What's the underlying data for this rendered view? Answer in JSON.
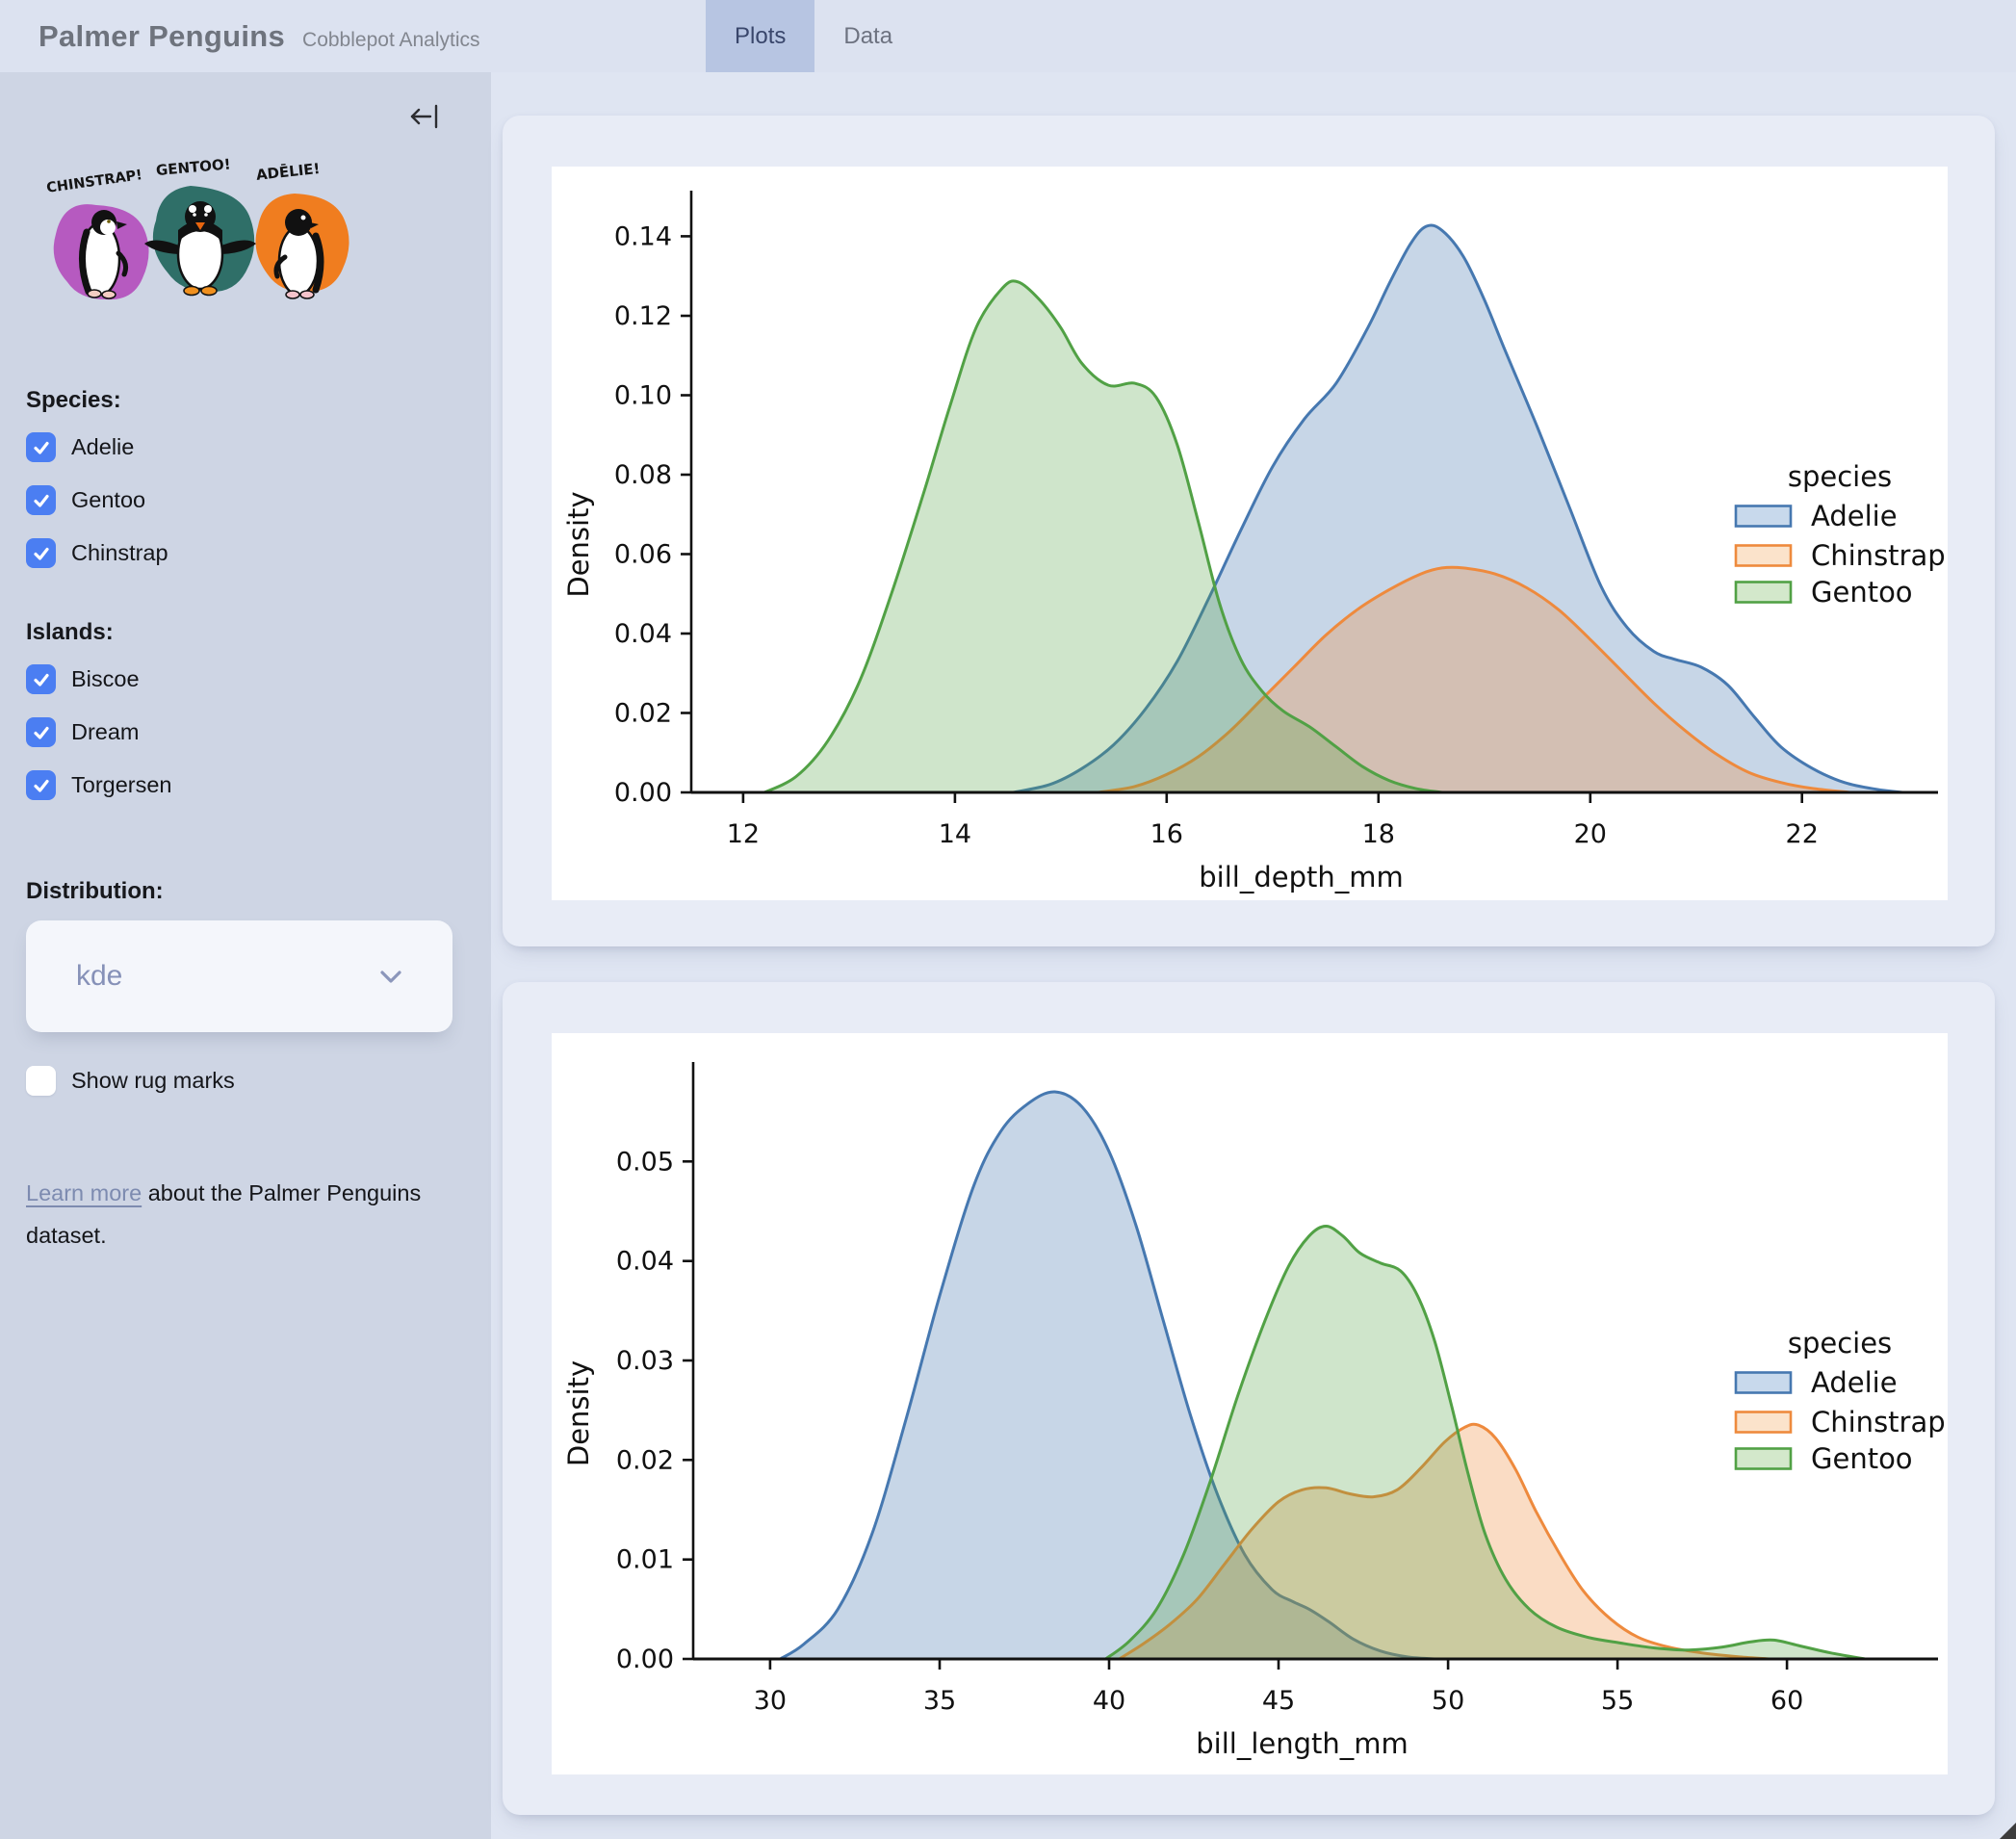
{
  "header": {
    "title": "Palmer Penguins",
    "subtitle": "Cobblepot Analytics",
    "tabs": [
      {
        "label": "Plots",
        "active": true
      },
      {
        "label": "Data",
        "active": false
      }
    ]
  },
  "sidebar": {
    "collapse_icon": "arrow-to-bar-left",
    "penguin_labels": [
      "CHINSTRAP!",
      "GENTOO!",
      "ADĒLIE!"
    ],
    "penguin_splash_colors": [
      "#b65ac0",
      "#2f6f68",
      "#f07d1f"
    ],
    "species_label": "Species:",
    "species": [
      {
        "label": "Adelie",
        "checked": true
      },
      {
        "label": "Gentoo",
        "checked": true
      },
      {
        "label": "Chinstrap",
        "checked": true
      }
    ],
    "islands_label": "Islands:",
    "islands": [
      {
        "label": "Biscoe",
        "checked": true
      },
      {
        "label": "Dream",
        "checked": true
      },
      {
        "label": "Torgersen",
        "checked": true
      }
    ],
    "distribution_label": "Distribution:",
    "distribution_value": "kde",
    "rug_label": "Show rug marks",
    "rug_checked": false,
    "learn_more_link": "Learn more",
    "learn_more_rest": " about the Palmer Penguins dataset.",
    "checkbox_color": "#4b7ef2"
  },
  "chart_data": [
    {
      "type": "area",
      "kind": "kde-density",
      "title": "",
      "xlabel": "bill_depth_mm",
      "ylabel": "Density",
      "xlim": [
        11.51,
        23.03
      ],
      "ylim": [
        0,
        0.1515
      ],
      "grid": false,
      "legend": {
        "title": "species",
        "position": "center right"
      },
      "xticks": {
        "values": [
          12,
          14,
          16,
          18,
          20,
          22
        ],
        "labels": [
          "12",
          "14",
          "16",
          "18",
          "20",
          "22"
        ]
      },
      "yticks": {
        "values": [
          0,
          0.02,
          0.04,
          0.06,
          0.08,
          0.1,
          0.12,
          0.14
        ],
        "labels": [
          "0.00",
          "0.02",
          "0.04",
          "0.06",
          "0.08",
          "0.10",
          "0.12",
          "0.14"
        ]
      },
      "series": [
        {
          "name": "Adelie",
          "line_color": "#4678b0",
          "fill_color": "rgba(70,120,176,0.30)",
          "swatch_fill": "#c8d9ec",
          "points": [
            [
              14.55,
              0
            ],
            [
              14.9,
              0.002
            ],
            [
              15.2,
              0.006
            ],
            [
              15.5,
              0.012
            ],
            [
              15.8,
              0.021
            ],
            [
              16.1,
              0.033
            ],
            [
              16.4,
              0.049
            ],
            [
              16.7,
              0.066
            ],
            [
              17.0,
              0.082
            ],
            [
              17.3,
              0.094
            ],
            [
              17.6,
              0.103
            ],
            [
              17.9,
              0.117
            ],
            [
              18.1,
              0.128
            ],
            [
              18.3,
              0.138
            ],
            [
              18.45,
              0.1425
            ],
            [
              18.6,
              0.1415
            ],
            [
              18.8,
              0.135
            ],
            [
              19.0,
              0.124
            ],
            [
              19.2,
              0.111
            ],
            [
              19.5,
              0.092
            ],
            [
              19.8,
              0.072
            ],
            [
              20.1,
              0.052
            ],
            [
              20.35,
              0.0415
            ],
            [
              20.6,
              0.0355
            ],
            [
              20.8,
              0.0335
            ],
            [
              21.05,
              0.0315
            ],
            [
              21.3,
              0.027
            ],
            [
              21.55,
              0.019
            ],
            [
              21.8,
              0.0115
            ],
            [
              22.1,
              0.006
            ],
            [
              22.4,
              0.0025
            ],
            [
              22.7,
              0.0008
            ],
            [
              22.95,
              0
            ]
          ]
        },
        {
          "name": "Chinstrap",
          "line_color": "#ee8a3d",
          "fill_color": "rgba(238,138,61,0.30)",
          "swatch_fill": "#fbe3cb",
          "points": [
            [
              15.35,
              0
            ],
            [
              15.7,
              0.0015
            ],
            [
              16.0,
              0.0045
            ],
            [
              16.3,
              0.009
            ],
            [
              16.6,
              0.0155
            ],
            [
              16.9,
              0.0235
            ],
            [
              17.2,
              0.0315
            ],
            [
              17.5,
              0.0395
            ],
            [
              17.8,
              0.046
            ],
            [
              18.1,
              0.051
            ],
            [
              18.4,
              0.055
            ],
            [
              18.6,
              0.0565
            ],
            [
              18.8,
              0.0565
            ],
            [
              19.1,
              0.055
            ],
            [
              19.4,
              0.0515
            ],
            [
              19.7,
              0.046
            ],
            [
              20.0,
              0.0385
            ],
            [
              20.3,
              0.0305
            ],
            [
              20.6,
              0.0225
            ],
            [
              20.9,
              0.0155
            ],
            [
              21.2,
              0.0095
            ],
            [
              21.5,
              0.005
            ],
            [
              21.8,
              0.0025
            ],
            [
              22.1,
              0.001
            ],
            [
              22.45,
              0
            ]
          ]
        },
        {
          "name": "Gentoo",
          "line_color": "#51a145",
          "fill_color": "rgba(81,161,69,0.28)",
          "swatch_fill": "#d3e8cb",
          "points": [
            [
              12.2,
              0
            ],
            [
              12.5,
              0.004
            ],
            [
              12.8,
              0.013
            ],
            [
              13.1,
              0.028
            ],
            [
              13.4,
              0.05
            ],
            [
              13.7,
              0.075
            ],
            [
              13.95,
              0.097
            ],
            [
              14.2,
              0.117
            ],
            [
              14.45,
              0.127
            ],
            [
              14.6,
              0.1285
            ],
            [
              14.8,
              0.124
            ],
            [
              15.0,
              0.117
            ],
            [
              15.2,
              0.108
            ],
            [
              15.45,
              0.1025
            ],
            [
              15.7,
              0.103
            ],
            [
              15.9,
              0.0995
            ],
            [
              16.1,
              0.0875
            ],
            [
              16.3,
              0.068
            ],
            [
              16.5,
              0.0475
            ],
            [
              16.7,
              0.0335
            ],
            [
              16.9,
              0.0255
            ],
            [
              17.1,
              0.0205
            ],
            [
              17.35,
              0.0165
            ],
            [
              17.6,
              0.0115
            ],
            [
              17.85,
              0.0065
            ],
            [
              18.1,
              0.003
            ],
            [
              18.35,
              0.001
            ],
            [
              18.6,
              0
            ]
          ]
        }
      ]
    },
    {
      "type": "area",
      "kind": "kde-density",
      "title": "",
      "xlabel": "bill_length_mm",
      "ylabel": "Density",
      "xlim": [
        27.73,
        63.66
      ],
      "ylim": [
        0,
        0.06
      ],
      "grid": false,
      "legend": {
        "title": "species",
        "position": "center right"
      },
      "xticks": {
        "values": [
          30,
          35,
          40,
          45,
          50,
          55,
          60
        ],
        "labels": [
          "30",
          "35",
          "40",
          "45",
          "50",
          "55",
          "60"
        ]
      },
      "yticks": {
        "values": [
          0,
          0.01,
          0.02,
          0.03,
          0.04,
          0.05
        ],
        "labels": [
          "0.00",
          "0.01",
          "0.02",
          "0.03",
          "0.04",
          "0.05"
        ]
      },
      "series": [
        {
          "name": "Adelie",
          "line_color": "#4678b0",
          "fill_color": "rgba(70,120,176,0.30)",
          "swatch_fill": "#c8d9ec",
          "points": [
            [
              30.3,
              0
            ],
            [
              31,
              0.0015
            ],
            [
              32,
              0.005
            ],
            [
              33,
              0.0125
            ],
            [
              34,
              0.024
            ],
            [
              35,
              0.0365
            ],
            [
              36,
              0.0475
            ],
            [
              36.8,
              0.053
            ],
            [
              37.6,
              0.0558
            ],
            [
              38.4,
              0.057
            ],
            [
              39.2,
              0.0555
            ],
            [
              40,
              0.051
            ],
            [
              40.8,
              0.0435
            ],
            [
              41.6,
              0.034
            ],
            [
              42.4,
              0.0245
            ],
            [
              43.2,
              0.0165
            ],
            [
              44,
              0.0105
            ],
            [
              44.8,
              0.007
            ],
            [
              45.4,
              0.0058
            ],
            [
              45.9,
              0.005
            ],
            [
              46.5,
              0.0037
            ],
            [
              47.2,
              0.002
            ],
            [
              48,
              0.0008
            ],
            [
              48.8,
              0.0002
            ],
            [
              49.6,
              0
            ]
          ]
        },
        {
          "name": "Chinstrap",
          "line_color": "#ee8a3d",
          "fill_color": "rgba(238,138,61,0.30)",
          "swatch_fill": "#fbe3cb",
          "points": [
            [
              40.3,
              0
            ],
            [
              41,
              0.0015
            ],
            [
              41.8,
              0.0035
            ],
            [
              42.6,
              0.006
            ],
            [
              43.4,
              0.0095
            ],
            [
              44.2,
              0.013
            ],
            [
              45,
              0.0158
            ],
            [
              45.7,
              0.017
            ],
            [
              46.4,
              0.0172
            ],
            [
              47.1,
              0.0166
            ],
            [
              47.8,
              0.0163
            ],
            [
              48.5,
              0.017
            ],
            [
              49.2,
              0.0192
            ],
            [
              49.9,
              0.0218
            ],
            [
              50.5,
              0.0233
            ],
            [
              50.9,
              0.0235
            ],
            [
              51.4,
              0.0222
            ],
            [
              52,
              0.019
            ],
            [
              52.6,
              0.0148
            ],
            [
              53.3,
              0.0105
            ],
            [
              54,
              0.0068
            ],
            [
              54.8,
              0.004
            ],
            [
              55.6,
              0.0022
            ],
            [
              56.5,
              0.0012
            ],
            [
              57.5,
              0.0006
            ],
            [
              58.6,
              0.0002
            ],
            [
              59.5,
              0
            ]
          ]
        },
        {
          "name": "Gentoo",
          "line_color": "#51a145",
          "fill_color": "rgba(81,161,69,0.28)",
          "swatch_fill": "#d3e8cb",
          "points": [
            [
              39.9,
              0
            ],
            [
              40.6,
              0.0018
            ],
            [
              41.4,
              0.005
            ],
            [
              42.2,
              0.0105
            ],
            [
              43,
              0.018
            ],
            [
              43.8,
              0.0265
            ],
            [
              44.6,
              0.034
            ],
            [
              45.3,
              0.0395
            ],
            [
              45.9,
              0.0425
            ],
            [
              46.4,
              0.0435
            ],
            [
              46.9,
              0.0425
            ],
            [
              47.4,
              0.0408
            ],
            [
              48.0,
              0.0398
            ],
            [
              48.6,
              0.039
            ],
            [
              49.1,
              0.0365
            ],
            [
              49.6,
              0.032
            ],
            [
              50.1,
              0.0255
            ],
            [
              50.6,
              0.0185
            ],
            [
              51.1,
              0.0125
            ],
            [
              51.7,
              0.008
            ],
            [
              52.4,
              0.005
            ],
            [
              53.2,
              0.0032
            ],
            [
              54.1,
              0.0022
            ],
            [
              55.1,
              0.0016
            ],
            [
              56.1,
              0.0011
            ],
            [
              57.1,
              0.0009
            ],
            [
              58.1,
              0.0012
            ],
            [
              58.9,
              0.0017
            ],
            [
              59.6,
              0.0019
            ],
            [
              60.4,
              0.0013
            ],
            [
              61.3,
              0.0006
            ],
            [
              62.3,
              0
            ]
          ]
        }
      ]
    }
  ]
}
